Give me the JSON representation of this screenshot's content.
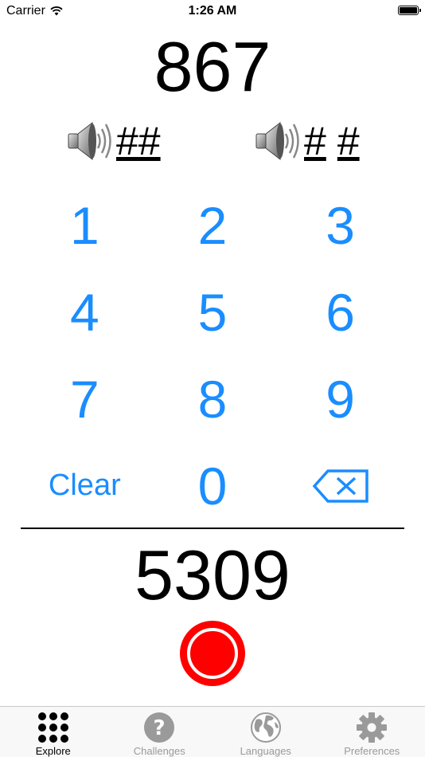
{
  "status_bar": {
    "carrier": "Carrier",
    "time": "1:26 AM"
  },
  "top_number": "867",
  "patterns": {
    "left": {
      "icon": "speaker-icon",
      "text": "##"
    },
    "right": {
      "icon": "speaker-icon",
      "text_a": "#",
      "text_b": "#"
    }
  },
  "keypad": {
    "keys": [
      "1",
      "2",
      "3",
      "4",
      "5",
      "6",
      "7",
      "8",
      "9"
    ],
    "clear_label": "Clear",
    "zero": "0",
    "backspace_icon": "backspace-icon"
  },
  "bottom_number": "5309",
  "record": {
    "icon": "record-icon",
    "color": "#ff0000"
  },
  "tabs": [
    {
      "label": "Explore",
      "icon": "grid-dots-icon",
      "active": true
    },
    {
      "label": "Challenges",
      "icon": "question-icon",
      "active": false
    },
    {
      "label": "Languages",
      "icon": "globe-icon",
      "active": false
    },
    {
      "label": "Preferences",
      "icon": "gear-icon",
      "active": false
    }
  ],
  "colors": {
    "accent": "#1a8dff",
    "record": "#ff0000",
    "inactive_tab": "#9a9a9a"
  }
}
